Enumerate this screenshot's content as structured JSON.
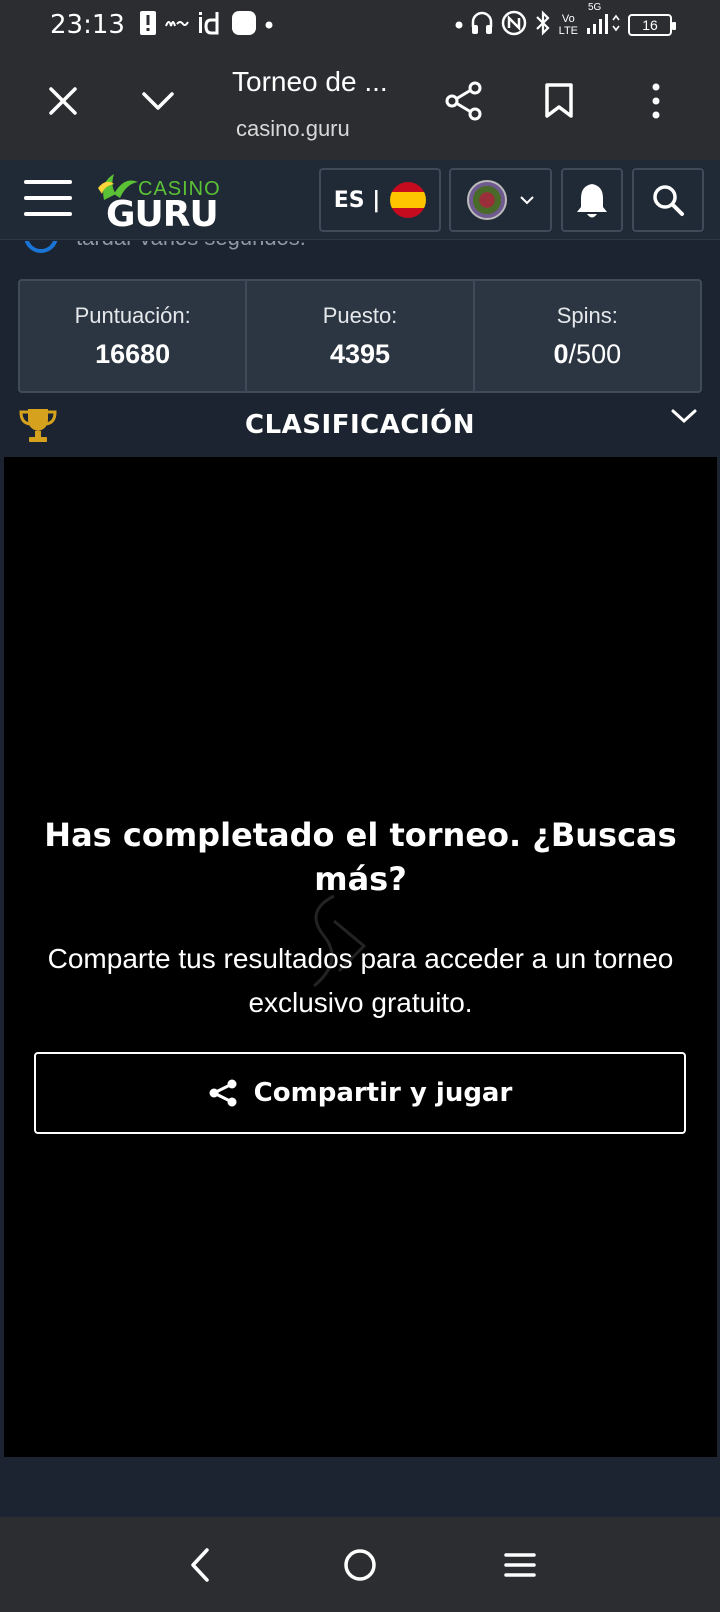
{
  "status_bar": {
    "time": "23:13",
    "left_icons": [
      "alert-icon",
      "moyo-icon",
      "id-icon",
      "app-icon",
      "dot-icon"
    ],
    "network_label_top": "Vo",
    "network_label_bottom": "LTE",
    "network_gen": "5G",
    "battery": "16"
  },
  "browser": {
    "title": "Torneo de ...",
    "url": "casino.guru"
  },
  "header": {
    "logo_casino": "CASINO",
    "logo_guru": "GURU",
    "language": "ES |"
  },
  "info": {
    "text": "tardar varios segundos."
  },
  "stats": [
    {
      "label": "Puntuación:",
      "value": "16680",
      "suffix": ""
    },
    {
      "label": "Puesto:",
      "value": "4395",
      "suffix": ""
    },
    {
      "label": "Spins:",
      "value": "0",
      "suffix": "/500"
    }
  ],
  "leaderboard": {
    "title": "CLASIFICACIÓN"
  },
  "game": {
    "done_title": "Has completado el torneo. ¿Buscas más?",
    "done_subtitle": "Comparte tus resultados para acceder a un torneo exclusivo gratuito.",
    "share_button": "Compartir y jugar"
  },
  "colors": {
    "accent_blue": "#1a74d6",
    "logo_green": "#5bc236",
    "trophy_gold": "#d6a21e",
    "header_bg": "#202a36",
    "content_bg": "#1b2430",
    "system_bar_bg": "#2b2d31"
  }
}
